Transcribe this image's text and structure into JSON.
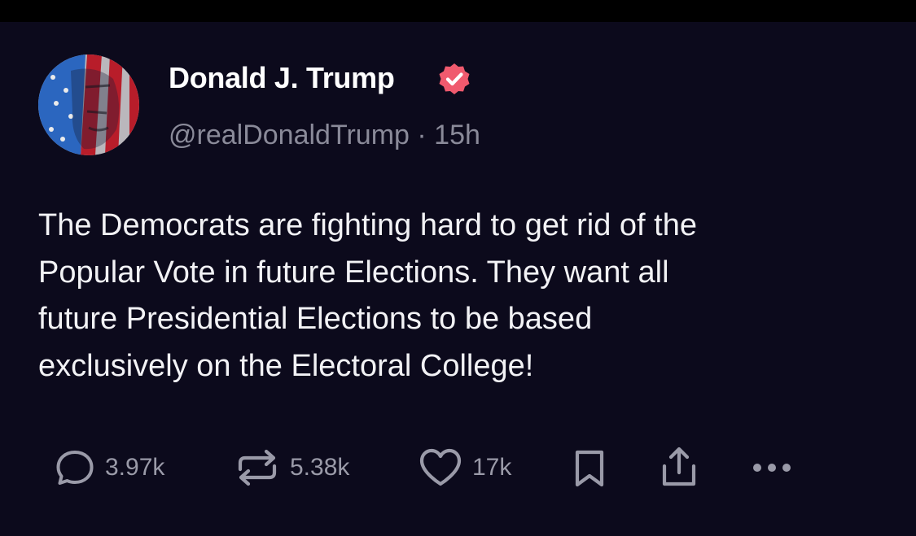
{
  "post": {
    "author": {
      "display_name": "Donald J. Trump",
      "handle": "@realDonaldTrump",
      "separator": "·",
      "time_ago": "15h"
    },
    "text": "The Democrats are fighting hard to get rid of the\nPopular Vote in future Elections. They want all\nfuture Presidential Elections to be based\nexclusively on the Electoral College!",
    "actions": {
      "reply_count": "3.97k",
      "repost_count": "5.38k",
      "like_count": "17k"
    }
  },
  "icons": {
    "reply": "speech-bubble-icon",
    "repost": "repost-arrows-icon",
    "like": "heart-icon",
    "bookmark": "bookmark-icon",
    "share": "share-upload-icon",
    "more": "more-dots-icon",
    "verified": "verified-badge-icon"
  },
  "colors": {
    "background": "#0c0a1c",
    "verified_badge": "#f05a6e",
    "action_gray": "#9a9aa8"
  }
}
